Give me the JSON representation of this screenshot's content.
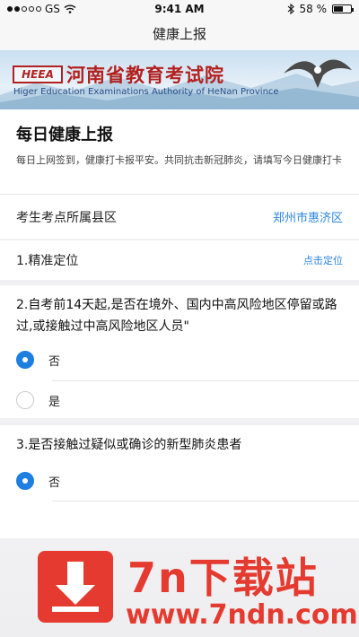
{
  "status_bar": {
    "carrier": "GS",
    "time": "9:41 AM",
    "battery": "58 %",
    "battery_level": 0.58
  },
  "nav": {
    "title": "健康上报"
  },
  "banner": {
    "logo_text": "HEEA",
    "title": "河南省教育考试院",
    "subtitle": "Higer Education Examinations Authority of HeNan Province"
  },
  "intro": {
    "title": "每日健康上报",
    "desc": "每日上网签到，健康打卡报平安。共同抗击新冠肺炎，请填写今日健康打卡"
  },
  "county": {
    "label": "考生考点所属县区",
    "value": "郑州市惠济区"
  },
  "location": {
    "label": "1.精准定位",
    "action": "点击定位"
  },
  "question2": {
    "title": "2.自考前14天起,是否在境外、国内中高风险地区停留或路过,或接触过中高风险地区人员\"",
    "options": [
      {
        "label": "否",
        "checked": true
      },
      {
        "label": "是",
        "checked": false
      }
    ]
  },
  "question3": {
    "title": "3.是否接触过疑似或确诊的新型肺炎患者",
    "options": [
      {
        "label": "否",
        "checked": true
      }
    ]
  },
  "watermark": {
    "brand": "7n下载站",
    "url": "www.7ndn.com"
  },
  "colors": {
    "accent": "#1f7fe0",
    "link": "#2b86e0",
    "brand_red": "#b3211f",
    "watermark_red": "#e53a2f"
  }
}
